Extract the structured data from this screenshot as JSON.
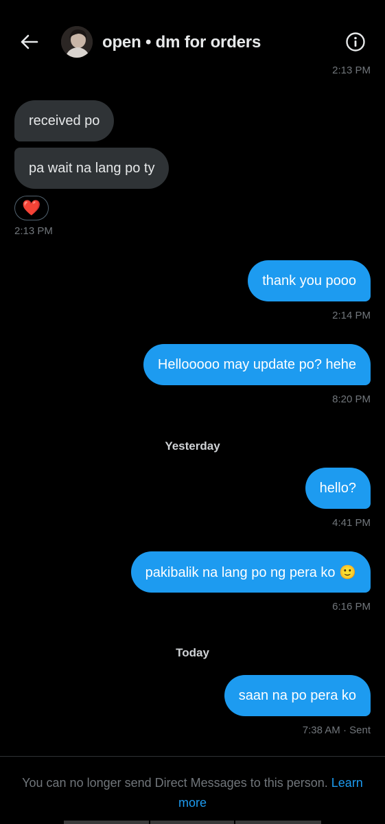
{
  "header": {
    "title": "open • dm for orders",
    "back_icon": "arrow-left-icon",
    "info_icon": "info-circle-icon"
  },
  "messages": {
    "top_timestamp": "2:13 PM",
    "received": [
      {
        "text": "received po"
      },
      {
        "text": "pa wait na lang po ty"
      }
    ],
    "reaction": "❤️",
    "received_timestamp": "2:13 PM",
    "sent": [
      {
        "text": "thank you pooo",
        "time": "2:14 PM"
      },
      {
        "text": "Hellooooo may update po? hehe",
        "time": "8:20 PM"
      },
      {
        "text": "hello?",
        "time": "4:41 PM"
      },
      {
        "text": "pakibalik na lang po ng pera ko 🙂",
        "time": "6:16 PM"
      },
      {
        "text": "saan na po pera ko",
        "time": "7:38 AM · Sent"
      }
    ],
    "separators": {
      "yesterday": "Yesterday",
      "today": "Today"
    }
  },
  "footer": {
    "notice": "You can no longer send Direct Messages to this person.",
    "link": "Learn more"
  },
  "colors": {
    "background": "#000000",
    "sent_bubble": "#1d9bf0",
    "received_bubble": "#2f3336",
    "muted_text": "#71767b",
    "link": "#1d9bf0"
  }
}
